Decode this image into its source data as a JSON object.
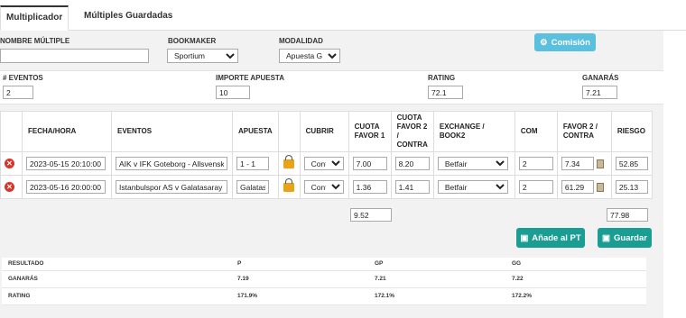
{
  "tabs": [
    "Multiplicador",
    "Múltiples Guardadas"
  ],
  "form": {
    "nombre_label": "NOMBRE MÚLTIPLE",
    "nombre_value": "",
    "bookmaker_label": "BOOKMAKER",
    "bookmaker_value": "Sportium",
    "modalidad_label": "MODALIDAD",
    "modalidad_value": "Apuesta Gratis",
    "comision_label": "Comisión",
    "eventos_label": "# EVENTOS",
    "eventos_value": "2",
    "importe_label": "IMPORTE APUESTA",
    "importe_value": "10",
    "rating_label": "RATING",
    "rating_value": "72.1",
    "ganaras_label": "GANARÁS",
    "ganaras_value": "7.21"
  },
  "table": {
    "headers": [
      "FECHA/HORA",
      "EVENTOS",
      "APUESTA",
      "CUBRIR",
      "CUOTA FAVOR 1",
      "CUOTA FAVOR 2 / CONTRA",
      "EXCHANGE / BOOK2",
      "COM",
      "FAVOR 2 / CONTRA",
      "RIESGO"
    ],
    "rows": [
      {
        "fecha": "2023-05-15 20:10:00",
        "evento": "AIK v IFK Goteborg - Allsvenskan",
        "apuesta": "1 - 1",
        "cubrir": "Contra",
        "cuota1": "7.00",
        "cuota2": "8.20",
        "exchange": "Betfair",
        "com": "2",
        "favor2": "7.34",
        "riesgo": "52.85"
      },
      {
        "fecha": "2023-05-16 20:00:00",
        "evento": "Istanbulspor AS v Galatasaray - Super Lig",
        "apuesta": "Galatasaray",
        "cubrir": "Contra",
        "cuota1": "1.36",
        "cuota2": "1.41",
        "exchange": "Betfair",
        "com": "2",
        "favor2": "61.29",
        "riesgo": "25.13"
      }
    ],
    "total_cuota": "9.52",
    "total_riesgo": "77.98"
  },
  "actions": {
    "add_pt": "Añade al PT",
    "save": "Guardar"
  },
  "results": {
    "headers": [
      "RESULTADO",
      "P",
      "GP",
      "GG"
    ],
    "rows": [
      [
        "GANARÁS",
        "7.19",
        "7.21",
        "7.22"
      ],
      [
        "RATING",
        "171.9%",
        "172.1%",
        "172.2%"
      ]
    ]
  },
  "colors": {
    "primary_button": "#1a9e94",
    "comision_button": "#5bc0de",
    "delete_icon": "#d9342b"
  }
}
